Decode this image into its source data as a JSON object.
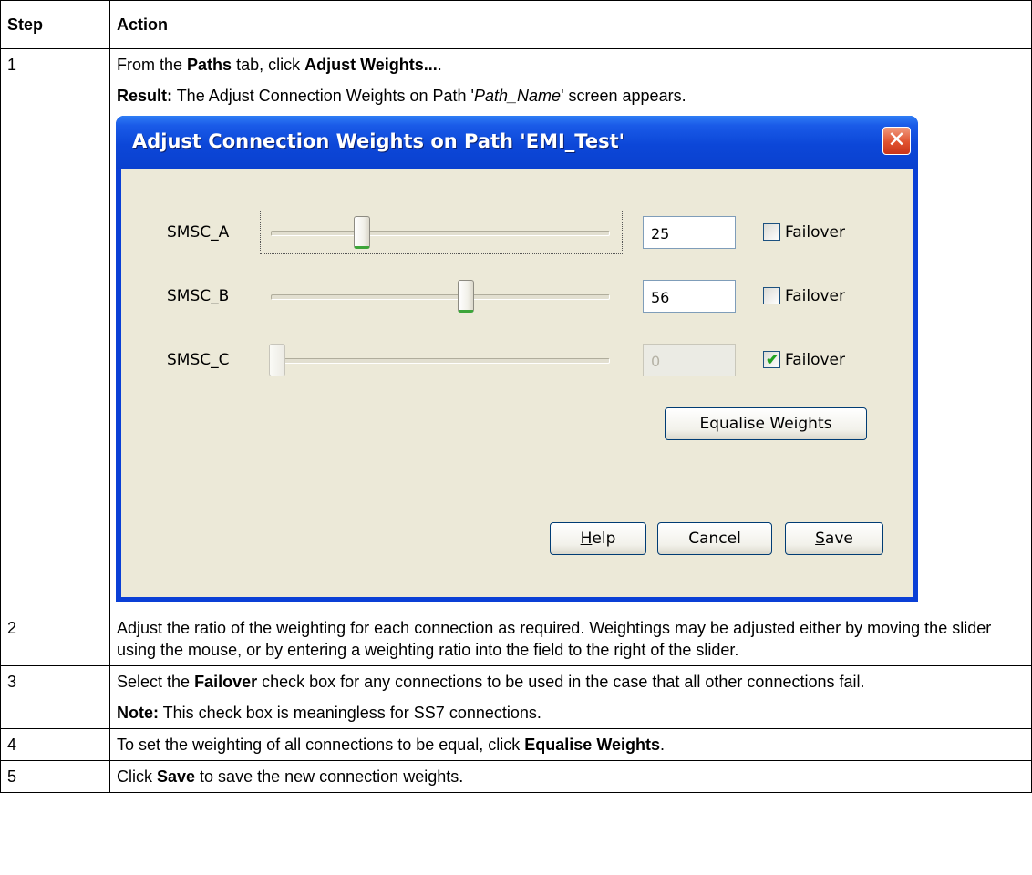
{
  "table": {
    "headers": {
      "step": "Step",
      "action": "Action"
    },
    "steps": {
      "s1": {
        "num": "1",
        "line1": {
          "pre": "From the ",
          "b1": "Paths",
          "mid": " tab, click ",
          "b2": "Adjust Weights...",
          "post": "."
        },
        "line2": {
          "b": "Result:",
          "pre": " The Adjust Connection Weights on Path '",
          "i": "Path_Name",
          "post": "' screen appears."
        }
      },
      "s2": {
        "num": "2",
        "text": "Adjust the ratio of the weighting for each connection as required. Weightings may be adjusted either by moving the slider using the mouse, or by entering a weighting ratio into the field to the right of the slider."
      },
      "s3": {
        "num": "3",
        "line1": {
          "pre": "Select the ",
          "b": "Failover",
          "post": " check box for any connections to be used in the case that all other connections fail."
        },
        "note": {
          "b": "Note:",
          "post": " This check box is meaningless for SS7 connections."
        }
      },
      "s4": {
        "num": "4",
        "pre": "To set the weighting of all connections to be equal, click ",
        "b": "Equalise Weights",
        "post": "."
      },
      "s5": {
        "num": "5",
        "pre": "Click ",
        "b": "Save",
        "post": " to save the new connection weights."
      }
    }
  },
  "dialog": {
    "title": "Adjust Connection Weights on Path 'EMI_Test'",
    "close_glyph": "✕",
    "connections": [
      {
        "label": "SMSC_A",
        "value": "25",
        "weight": 25,
        "failover": false,
        "enabled": true,
        "checkbox_label": "Failover"
      },
      {
        "label": "SMSC_B",
        "value": "56",
        "weight": 56,
        "failover": false,
        "enabled": true,
        "checkbox_label": "Failover"
      },
      {
        "label": "SMSC_C",
        "value": "0",
        "weight": 0,
        "failover": true,
        "enabled": false,
        "checkbox_label": "Failover"
      }
    ],
    "check_glyph": "✔",
    "equalise_label": "Equalise Weights",
    "buttons": {
      "help": {
        "mnemonic": "H",
        "rest": "elp"
      },
      "cancel": "Cancel",
      "save": {
        "mnemonic": "S",
        "rest": "ave"
      }
    }
  }
}
